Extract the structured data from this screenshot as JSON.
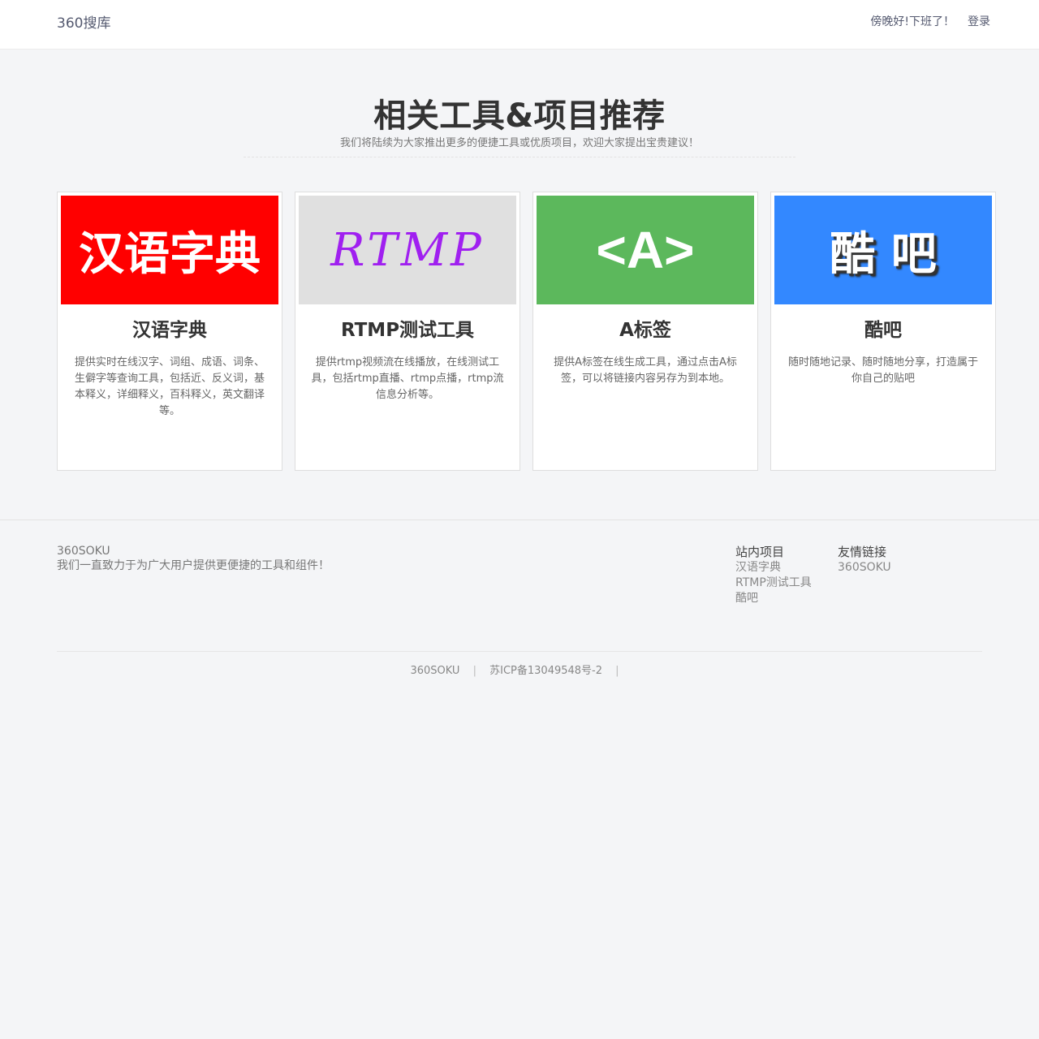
{
  "header": {
    "brand": "360搜库",
    "greeting": "傍晚好!下班了！",
    "login": "登录"
  },
  "section": {
    "title": "相关工具&项目推荐",
    "subtitle": "我们将陆续为大家推出更多的便捷工具或优质项目，欢迎大家提出宝贵建议！"
  },
  "cards": [
    {
      "cover_text": "汉语字典",
      "cover_bg": "#ff0000",
      "title": "汉语字典",
      "desc": "提供实时在线汉字、词组、成语、词条、生僻字等查询工具，包括近、反义词，基本释义，详细释义，百科释义，英文翻译等。"
    },
    {
      "cover_text": "RTMP",
      "cover_bg": "#e0e0e0",
      "title": "RTMP测试工具",
      "desc": "提供rtmp视频流在线播放，在线测试工具，包括rtmp直播、rtmp点播，rtmp流信息分析等。"
    },
    {
      "cover_text": "<A>",
      "cover_bg": "#5cb85c",
      "title": "A标签",
      "desc": "提供A标签在线生成工具，通过点击A标签，可以将链接内容另存为到本地。"
    },
    {
      "cover_text": "酷 吧",
      "cover_bg": "#3388ff",
      "title": "酷吧",
      "desc": "随时随地记录、随时随地分享，打造属于你自己的贴吧"
    }
  ],
  "footer": {
    "brand": "360SOKU",
    "slogan": "我们一直致力于为广大用户提供更便捷的工具和组件！",
    "projects_title": "站内项目",
    "projects": [
      "汉语字典",
      "RTMP测试工具",
      "酷吧"
    ],
    "links_title": "友情链接",
    "links": [
      "360SOKU"
    ],
    "copyright": "360SOKU",
    "icp": "苏ICP备13049548号-2",
    "sep": "|"
  }
}
